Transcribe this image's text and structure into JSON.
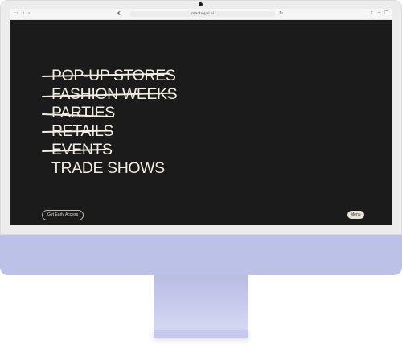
{
  "browser": {
    "url": "reactroyal.ai"
  },
  "hero": {
    "items": [
      {
        "label": "POP-UP STORES",
        "struck": true
      },
      {
        "label": "FASHION WEEKS",
        "struck": true
      },
      {
        "label": "PARTIES",
        "struck": true
      },
      {
        "label": "RETAILS",
        "struck": true
      },
      {
        "label": "EVENTS",
        "struck": true
      },
      {
        "label": "TRADE SHOWS",
        "struck": false
      }
    ]
  },
  "actions": {
    "early_access_label": "Get Early Access",
    "menu_label": "Menu"
  },
  "colors": {
    "screen_bg": "#1b1b1b",
    "text": "#f1ede2",
    "imac_body": "#bcc2e7"
  }
}
